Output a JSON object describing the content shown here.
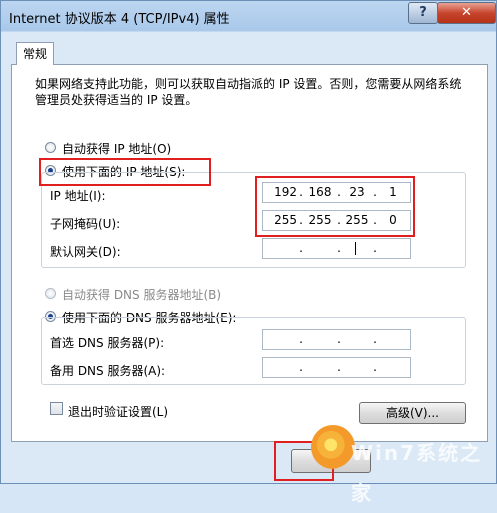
{
  "window": {
    "title": "Internet 协议版本 4 (TCP/IPv4) 属性",
    "help_label": "?",
    "close_label": "✕"
  },
  "tab": {
    "label": "常规"
  },
  "description": "如果网络支持此功能，则可以获取自动指派的 IP 设置。否则，您需要从网络系统管理员处获得适当的 IP 设置。",
  "ip_section": {
    "auto_label": "自动获得 IP 地址(O)",
    "manual_label": "使用下面的 IP 地址(S):",
    "selected": "manual",
    "fields": [
      {
        "label": "IP 地址(I):",
        "octets": [
          "192",
          "168",
          "23",
          "1"
        ]
      },
      {
        "label": "子网掩码(U):",
        "octets": [
          "255",
          "255",
          "255",
          "0"
        ]
      },
      {
        "label": "默认网关(D):",
        "octets": [
          "",
          "",
          "",
          ""
        ]
      }
    ]
  },
  "dns_section": {
    "auto_label": "自动获得 DNS 服务器地址(B)",
    "manual_label": "使用下面的 DNS 服务器地址(E):",
    "selected": "manual",
    "fields": [
      {
        "label": "首选 DNS 服务器(P):",
        "octets": [
          "",
          "",
          "",
          ""
        ]
      },
      {
        "label": "备用 DNS 服务器(A):",
        "octets": [
          "",
          "",
          "",
          ""
        ]
      }
    ]
  },
  "validate_label": "退出时验证设置(L)",
  "validate_checked": false,
  "advanced_label": "高级(V)...",
  "watermark": "Win7系统之家",
  "colors": {
    "highlight": "#e02020",
    "accent": "#1a3f8f"
  }
}
